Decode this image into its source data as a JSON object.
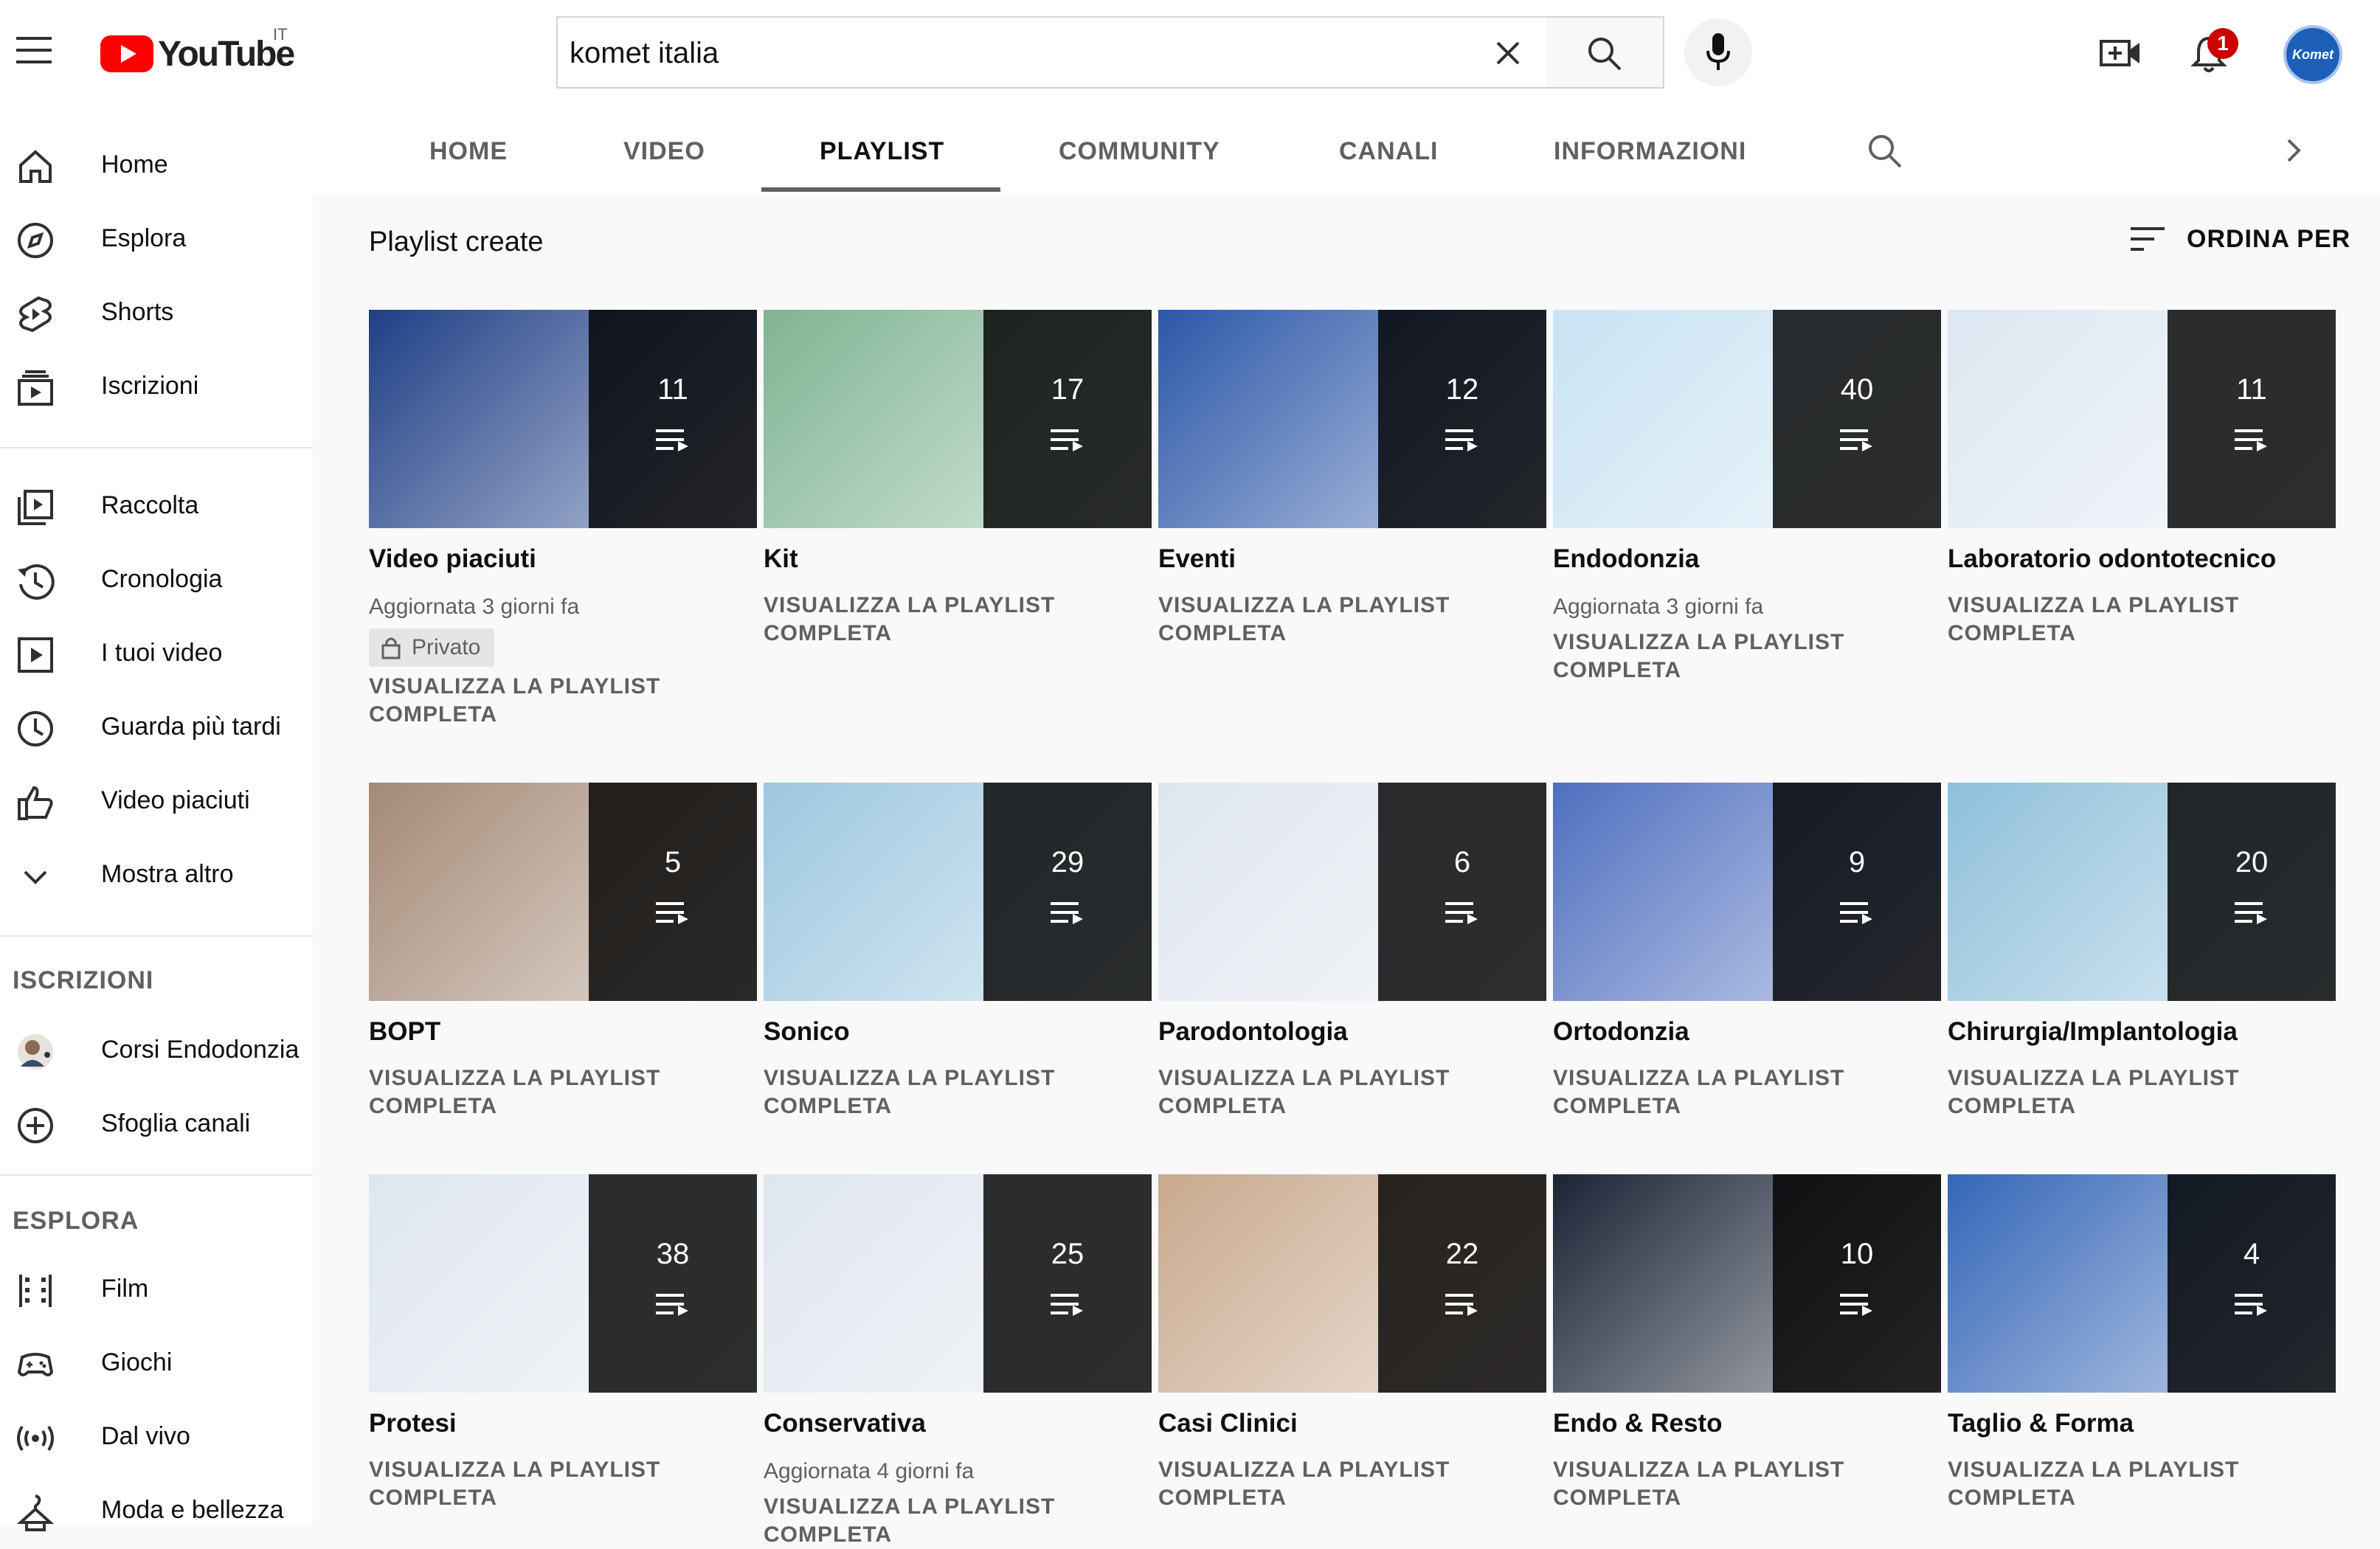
{
  "header": {
    "logo_text": "YouTube",
    "country_code": "IT",
    "search_value": "komet italia",
    "notification_count": "1",
    "avatar_text": "Komet"
  },
  "sidebar": {
    "main": [
      {
        "label": "Home",
        "icon": "home-icon"
      },
      {
        "label": "Esplora",
        "icon": "compass-icon"
      },
      {
        "label": "Shorts",
        "icon": "shorts-icon"
      },
      {
        "label": "Iscrizioni",
        "icon": "subscriptions-icon"
      }
    ],
    "library": [
      {
        "label": "Raccolta",
        "icon": "library-icon"
      },
      {
        "label": "Cronologia",
        "icon": "history-icon"
      },
      {
        "label": "I tuoi video",
        "icon": "your-videos-icon"
      },
      {
        "label": "Guarda più tardi",
        "icon": "clock-icon"
      },
      {
        "label": "Video piaciuti",
        "icon": "thumbs-up-icon"
      },
      {
        "label": "Mostra altro",
        "icon": "chevron-down-icon"
      }
    ],
    "subscriptions_heading": "ISCRIZIONI",
    "subscriptions": [
      {
        "label": "Corsi Endodonzia",
        "icon": "channel-avatar-icon"
      },
      {
        "label": "Sfoglia canali",
        "icon": "plus-circle-icon"
      }
    ],
    "explore_heading": "ESPLORA",
    "explore": [
      {
        "label": "Film",
        "icon": "film-icon"
      },
      {
        "label": "Giochi",
        "icon": "gamepad-icon"
      },
      {
        "label": "Dal vivo",
        "icon": "live-icon"
      },
      {
        "label": "Moda e bellezza",
        "icon": "hanger-icon"
      }
    ]
  },
  "tabs": [
    {
      "label": "HOME"
    },
    {
      "label": "VIDEO"
    },
    {
      "label": "PLAYLIST",
      "active": true
    },
    {
      "label": "COMMUNITY"
    },
    {
      "label": "CANALI"
    },
    {
      "label": "INFORMAZIONI"
    }
  ],
  "section": {
    "title": "Playlist create",
    "sort_label": "ORDINA PER"
  },
  "view_label_line1": "VISUALIZZA LA PLAYLIST",
  "view_label_line2": "COMPLETA",
  "playlists": [
    {
      "title": "Video piaciuti",
      "count": "11",
      "updated": "Aggiornata 3 giorni fa",
      "privacy": "Privato",
      "color": "#1f3f86"
    },
    {
      "title": "Kit",
      "count": "17",
      "updated": "",
      "color": "#7fb493"
    },
    {
      "title": "Eventi",
      "count": "12",
      "updated": "",
      "color": "#2b57a8"
    },
    {
      "title": "Endodonzia",
      "count": "40",
      "updated": "Aggiornata 3 giorni fa",
      "color": "#c9e3f3"
    },
    {
      "title": "Laboratorio odontotecnico",
      "count": "11",
      "updated": "",
      "color": "#dde7f1"
    },
    {
      "title": "BOPT",
      "count": "5",
      "updated": "",
      "color": "#a48a76"
    },
    {
      "title": "Sonico",
      "count": "29",
      "updated": "",
      "color": "#9dc7e0"
    },
    {
      "title": "Parodontologia",
      "count": "6",
      "updated": "",
      "color": "#dfe6ee"
    },
    {
      "title": "Ortodonzia",
      "count": "9",
      "updated": "",
      "color": "#4f6fbf"
    },
    {
      "title": "Chirurgia/Implantologia",
      "count": "20",
      "updated": "",
      "color": "#8ec0db"
    },
    {
      "title": "Protesi",
      "count": "38",
      "updated": "",
      "color": "#dfe6ee"
    },
    {
      "title": "Conservativa",
      "count": "25",
      "updated": "Aggiornata 4 giorni fa",
      "color": "#dfe6ee"
    },
    {
      "title": "Casi Clinici",
      "count": "22",
      "updated": "",
      "color": "#c9a98e"
    },
    {
      "title": "Endo & Resto",
      "count": "10",
      "updated": "",
      "color": "#1b2436"
    },
    {
      "title": "Taglio & Forma",
      "count": "4",
      "updated": "",
      "color": "#3567b8"
    }
  ]
}
